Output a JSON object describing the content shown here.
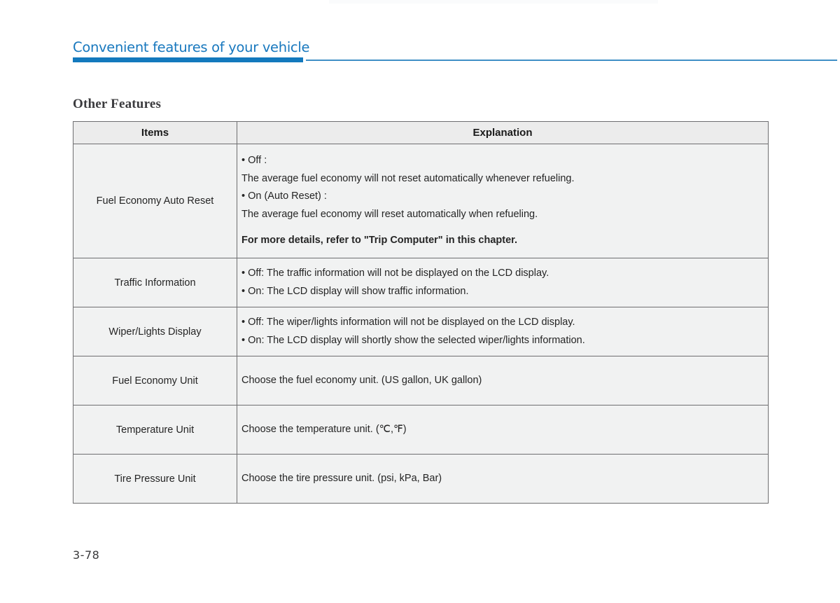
{
  "page": {
    "chapter_title": "Convenient features of your vehicle",
    "section_heading": "Other Features",
    "page_number": "3-78"
  },
  "colors": {
    "accent_blue": "#1379bd",
    "title_blue": "#1878be",
    "thin_rule_blue": "#3f8fc6",
    "table_header_bg": "#ececec",
    "table_cell_bg": "#f1f2f2",
    "table_border": "#6e6e70",
    "body_text": "#252525"
  },
  "table": {
    "columns": [
      "Items",
      "Explanation"
    ],
    "rows": [
      {
        "item": "Fuel Economy Auto Reset",
        "lines": [
          {
            "text": "• Off :",
            "bold": false
          },
          {
            "text": "The average fuel economy will not reset automatically whenever refueling.",
            "bold": false
          },
          {
            "text": "• On (Auto Reset) :",
            "bold": false
          },
          {
            "text": "The average fuel economy will reset automatically when refueling.",
            "bold": false
          },
          {
            "text": "For more details, refer to \"Trip Computer\" in this chapter.",
            "bold": true,
            "spacer_top": true
          }
        ]
      },
      {
        "item": "Traffic Information",
        "lines": [
          {
            "text": "• Off: The traffic information will not be displayed on the LCD display.",
            "bold": false
          },
          {
            "text": "• On: The LCD display will show traffic information.",
            "bold": false
          }
        ]
      },
      {
        "item": "Wiper/Lights Display",
        "lines": [
          {
            "text": "• Off: The wiper/lights information will not be displayed on the LCD display.",
            "bold": false
          },
          {
            "text": "• On: The LCD display will shortly show the selected wiper/lights information.",
            "bold": false
          }
        ]
      },
      {
        "item": "Fuel Economy Unit",
        "lines": [
          {
            "text": "Choose the fuel economy unit. (US gallon, UK gallon)",
            "bold": false
          }
        ]
      },
      {
        "item": "Temperature Unit",
        "lines": [
          {
            "text": "Choose the temperature unit. (℃,℉)",
            "bold": false
          }
        ]
      },
      {
        "item": "Tire Pressure Unit",
        "lines": [
          {
            "text": "Choose the tire pressure unit. (psi, kPa, Bar)",
            "bold": false
          }
        ]
      }
    ]
  }
}
